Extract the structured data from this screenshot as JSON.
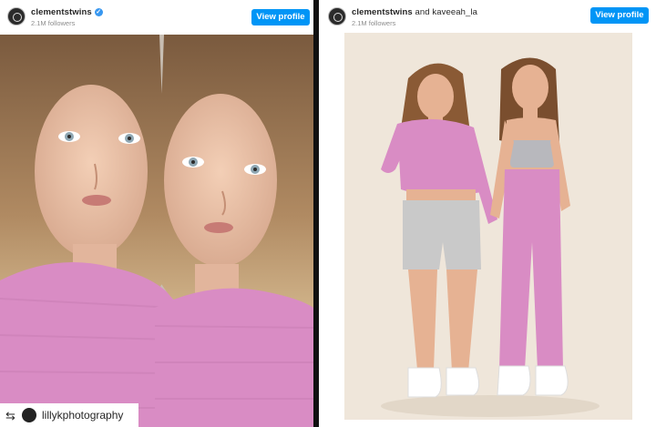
{
  "left_post": {
    "username": "clementstwins",
    "verified": true,
    "followers": "2.1M followers",
    "button_label": "View profile",
    "repost_credit": "lillykphotography",
    "icons": {
      "avatar": "profile-avatar",
      "verified": "verified-badge-icon",
      "repost": "repost-icon"
    }
  },
  "right_post": {
    "username": "clementstwins",
    "connector": " and ",
    "collaborator": "kaveeah_la",
    "followers": "2.1M followers",
    "button_label": "View profile"
  },
  "colors": {
    "button_blue": "#0095f6",
    "pink_sweater": "#d98cc4",
    "photo_background_left": "#b3a9a0",
    "photo_background_right": "#efe6da"
  }
}
